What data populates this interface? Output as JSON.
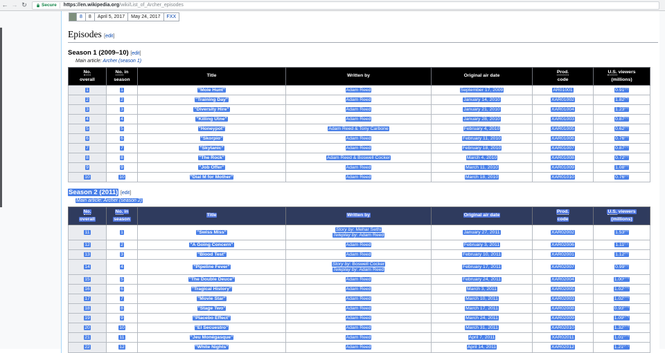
{
  "colors": {
    "selection_blue": "#4a80e8",
    "link_blue": "#0645ad",
    "secure_green": "#0b8043",
    "season1_header_bg": "#000000",
    "season2_header_bg": "#2f3b5e",
    "season8_swatch": "#7e8f7c",
    "content_border": "#a7d7f9",
    "table_border": "#a2a9b1"
  },
  "browser": {
    "secure_label": "Secure",
    "url_host": "https://en.wikipedia.org",
    "url_path": "/wiki/List_of_Archer_episodes"
  },
  "overview_row": {
    "season": "8",
    "episodes": "8",
    "first_aired": "April 5, 2017",
    "last_aired": "May 24, 2017",
    "network": "FXX"
  },
  "page": {
    "heading": "Episodes",
    "edit_label": "edit",
    "bracket_open": "[",
    "bracket_close": "]",
    "main_article_prefix": "Main article: "
  },
  "columns": [
    {
      "abbr": "No.",
      "rest": "",
      "line2": "overall"
    },
    {
      "abbr": "No.",
      "rest": " in",
      "line2": "season"
    },
    {
      "abbr": "",
      "rest": "Title",
      "line2": ""
    },
    {
      "abbr": "",
      "rest": "Written by",
      "line2": ""
    },
    {
      "abbr": "",
      "rest": "Original air date",
      "line2": ""
    },
    {
      "abbr": "Prod.",
      "rest": "",
      "line2": "code"
    },
    {
      "abbr": "U.S.",
      "rest": " viewers",
      "line2": "(millions)"
    }
  ],
  "seasons": [
    {
      "title": "Season 1 (2009–10)",
      "title_selected": false,
      "main_article_link": "Archer (season 1)",
      "main_article_selected": false,
      "header_bg": "#000000",
      "header_selected": false,
      "rows": [
        {
          "no_overall": "1",
          "no_season": "1",
          "title": "\"Mole Hunt\"",
          "written": "Adam Reed",
          "air": "September 17, 2009",
          "prod": "AR01001",
          "viewers": "0.91",
          "ref": "[3]"
        },
        {
          "no_overall": "2",
          "no_season": "2",
          "title": "\"Training Day\"",
          "written": "Adam Reed",
          "air": "January 14, 2010",
          "prod": "XAR01002",
          "viewers": "1.82",
          "ref": "[4]"
        },
        {
          "no_overall": "3",
          "no_season": "3",
          "title": "\"Diversity Hire\"",
          "written": "Adam Reed",
          "air": "January 21, 2010",
          "prod": "XAR01004",
          "viewers": "1.23",
          "ref": "[5]"
        },
        {
          "no_overall": "4",
          "no_season": "4",
          "title": "\"Killing Utne\"",
          "written": "Adam Reed",
          "air": "January 28, 2010",
          "prod": "XAR01003",
          "viewers": "0.87",
          "ref": "[5]"
        },
        {
          "no_overall": "5",
          "no_season": "5",
          "title": "\"Honeypot\"",
          "written": "Adam Reed & Tony Carbone",
          "air": "February 4, 2010",
          "prod": "XAR01005",
          "viewers": "0.62",
          "ref": "[5]"
        },
        {
          "no_overall": "6",
          "no_season": "6",
          "title": "\"Skorpio\"",
          "written": "Adam Reed",
          "air": "February 11, 2010",
          "prod": "XAR01006",
          "viewers": "0.76",
          "ref": "[5]"
        },
        {
          "no_overall": "7",
          "no_season": "7",
          "title": "\"Skytanic\"",
          "written": "Adam Reed",
          "air": "February 18, 2010",
          "prod": "XAR01007",
          "viewers": "0.87",
          "ref": "[5]"
        },
        {
          "no_overall": "8",
          "no_season": "8",
          "title": "\"The Rock\"",
          "written": "Adam Reed & Boswell Cocker",
          "air": "March 4, 2010",
          "prod": "XAR01008",
          "viewers": "0.72",
          "ref": "[5]"
        },
        {
          "no_overall": "9",
          "no_season": "9",
          "title": "\"Job Offer\"",
          "written": "Adam Reed",
          "air": "March 11, 2010",
          "prod": "XAR01009",
          "viewers": "1.08",
          "ref": "[5]"
        },
        {
          "no_overall": "10",
          "no_season": "10",
          "title": "\"Dial M for Mother\"",
          "written": "Adam Reed",
          "air": "March 18, 2010",
          "prod": "XAR01010",
          "viewers": "0.76",
          "ref": "[5]"
        }
      ]
    },
    {
      "title": "Season 2 (2011)",
      "title_selected": true,
      "main_article_link": "Archer (season 2)",
      "main_article_selected": true,
      "header_bg": "#2f3b5e",
      "header_selected": true,
      "rows": [
        {
          "no_overall": "11",
          "no_season": "1",
          "title": "\"Swiss Miss\"",
          "written_lines": [
            {
              "label": "Story by",
              "value": "Mehar Sethi"
            },
            {
              "label": "Teleplay by",
              "value": "Adam Reed"
            }
          ],
          "air": "January 27, 2011",
          "prod": "XAR02002",
          "viewers": "1.53",
          "ref": "[6]"
        },
        {
          "no_overall": "12",
          "no_season": "2",
          "title": "\"A Going Concern\"",
          "written": "Adam Reed",
          "air": "February 3, 2011",
          "prod": "XAR02006",
          "viewers": "1.11",
          "ref": "[7]"
        },
        {
          "no_overall": "13",
          "no_season": "3",
          "title": "\"Blood Test\"",
          "written": "Adam Reed",
          "air": "February 10, 2011",
          "prod": "XAR02001",
          "viewers": "1.12",
          "ref": "[8]"
        },
        {
          "no_overall": "14",
          "no_season": "4",
          "title": "\"Pipeline Fever\"",
          "written_lines": [
            {
              "label": "Story by",
              "value": "Boswell Cocker"
            },
            {
              "label": "Teleplay by",
              "value": "Adam Reed"
            }
          ],
          "air": "February 17, 2011",
          "prod": "XAR02007",
          "viewers": "0.99",
          "ref": "[9]"
        },
        {
          "no_overall": "15",
          "no_season": "5",
          "title": "\"The Double Deuce\"",
          "written": "Adam Reed",
          "air": "February 24, 2011",
          "prod": "XAR02004",
          "viewers": "1.00",
          "ref": "[10]"
        },
        {
          "no_overall": "16",
          "no_season": "6",
          "title": "\"Tragical History\"",
          "written": "Adam Reed",
          "air": "March 3, 2011",
          "prod": "XAR02005",
          "viewers": "1.02",
          "ref": "[11]"
        },
        {
          "no_overall": "17",
          "no_season": "7",
          "title": "\"Movie Star\"",
          "written": "Adam Reed",
          "air": "March 10, 2011",
          "prod": "XAR02003",
          "viewers": "1.02",
          "ref": "[12]"
        },
        {
          "no_overall": "18",
          "no_season": "8",
          "title": "\"Stage Two\"",
          "written": "Adam Reed",
          "air": "March 17, 2011",
          "prod": "XAR02008",
          "viewers": "0.93",
          "ref": "[13]"
        },
        {
          "no_overall": "19",
          "no_season": "9",
          "title": "\"Placebo Effect\"",
          "written": "Adam Reed",
          "air": "March 24, 2011",
          "prod": "XAR02009",
          "viewers": "1.09",
          "ref": "[14]"
        },
        {
          "no_overall": "20",
          "no_season": "10",
          "title": "\"El Secuestro\"",
          "written": "Adam Reed",
          "air": "March 31, 2011",
          "prod": "XAR02010",
          "viewers": "1.32",
          "ref": "[15]"
        },
        {
          "no_overall": "21",
          "no_season": "11",
          "title": "\"Jeu Monégasque\"",
          "written": "Adam Reed",
          "air": "April 7, 2011",
          "prod": "XAR02011",
          "viewers": "1.01",
          "ref": "[16]"
        },
        {
          "no_overall": "22",
          "no_season": "12",
          "title": "\"White Nights\"",
          "written": "Adam Reed",
          "air": "April 14, 2011",
          "prod": "XAR02012",
          "viewers": "1.21",
          "ref": "[17]"
        }
      ]
    }
  ]
}
